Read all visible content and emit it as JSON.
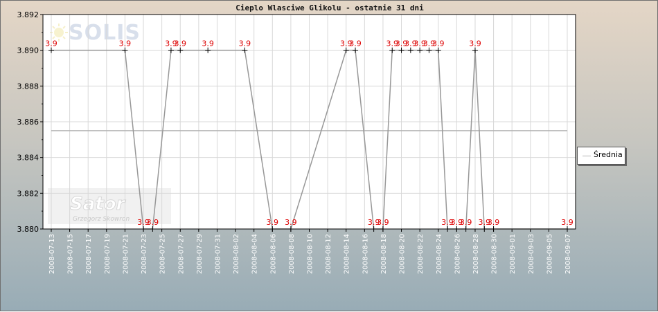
{
  "chart_data": {
    "type": "line",
    "title": "Cieplo Wlasciwe Glikolu - ostatnie 31 dni",
    "xlabel": "",
    "ylabel": "",
    "ylim": [
      3.88,
      3.892
    ],
    "yticks": [
      "3.880",
      "3.882",
      "3.884",
      "3.886",
      "3.888",
      "3.890",
      "3.892"
    ],
    "xlim": [
      "2008-07-13",
      "2008-09-07"
    ],
    "xticks": [
      "2008-07-13",
      "2008-07-15",
      "2008-07-17",
      "2008-07-19",
      "2008-07-21",
      "2008-07-23",
      "2008-07-25",
      "2008-07-27",
      "2008-07-29",
      "2008-07-31",
      "2008-08-02",
      "2008-08-04",
      "2008-08-06",
      "2008-08-08",
      "2008-08-10",
      "2008-08-12",
      "2008-08-14",
      "2008-08-16",
      "2008-08-18",
      "2008-08-20",
      "2008-08-22",
      "2008-08-24",
      "2008-08-26",
      "2008-08-28",
      "2008-08-30",
      "2008-09-01",
      "2008-09-03",
      "2008-09-05",
      "2008-09-07"
    ],
    "grid": true,
    "legend_position": "right",
    "series": [
      {
        "values": [
          {
            "x": "2008-07-13",
            "y": 3.89,
            "label": "3.9"
          },
          {
            "x": "2008-07-21",
            "y": 3.89,
            "label": "3.9"
          },
          {
            "x": "2008-07-23",
            "y": 3.88,
            "label": "3.9"
          },
          {
            "x": "2008-07-24",
            "y": 3.88,
            "label": "3.9"
          },
          {
            "x": "2008-07-26",
            "y": 3.89,
            "label": "3.9"
          },
          {
            "x": "2008-07-27",
            "y": 3.89,
            "label": "3.9"
          },
          {
            "x": "2008-07-30",
            "y": 3.89,
            "label": "3.9"
          },
          {
            "x": "2008-08-03",
            "y": 3.89,
            "label": "3.9"
          },
          {
            "x": "2008-08-06",
            "y": 3.88,
            "label": "3.9"
          },
          {
            "x": "2008-08-08",
            "y": 3.88,
            "label": "3.9"
          },
          {
            "x": "2008-08-14",
            "y": 3.89,
            "label": "3.9"
          },
          {
            "x": "2008-08-15",
            "y": 3.89,
            "label": "3.9"
          },
          {
            "x": "2008-08-17",
            "y": 3.88,
            "label": "3.9"
          },
          {
            "x": "2008-08-18",
            "y": 3.88,
            "label": "3.9"
          },
          {
            "x": "2008-08-19",
            "y": 3.89,
            "label": "3.9"
          },
          {
            "x": "2008-08-20",
            "y": 3.89,
            "label": "3.9"
          },
          {
            "x": "2008-08-21",
            "y": 3.89,
            "label": "3.9"
          },
          {
            "x": "2008-08-22",
            "y": 3.89,
            "label": "3.9"
          },
          {
            "x": "2008-08-23",
            "y": 3.89,
            "label": "3.9"
          },
          {
            "x": "2008-08-24",
            "y": 3.89,
            "label": "3.9"
          },
          {
            "x": "2008-08-25",
            "y": 3.88,
            "label": "3.9"
          },
          {
            "x": "2008-08-26",
            "y": 3.88,
            "label": "3.9"
          },
          {
            "x": "2008-08-27",
            "y": 3.88,
            "label": "3.9"
          },
          {
            "x": "2008-08-28",
            "y": 3.89,
            "label": "3.9"
          },
          {
            "x": "2008-08-29",
            "y": 3.88,
            "label": "3.9"
          },
          {
            "x": "2008-08-30",
            "y": 3.88,
            "label": "3.9"
          },
          {
            "x": "2008-09-07",
            "y": 3.88,
            "label": "3.9"
          }
        ],
        "color": "#989898"
      },
      {
        "name": "Średnia",
        "values": [
          {
            "x": "2008-07-13",
            "y": 3.8855
          },
          {
            "x": "2008-09-07",
            "y": 3.8855
          }
        ],
        "color": "#b4b4b4"
      }
    ],
    "colors": {
      "data_label": "#dd0000",
      "grid": "#d8d8d8",
      "axis_text": "#ffffff",
      "plot_bg": "#ffffff"
    },
    "watermarks": [
      "SOLIS",
      "Sator",
      "Grzegorz Skowron"
    ]
  }
}
